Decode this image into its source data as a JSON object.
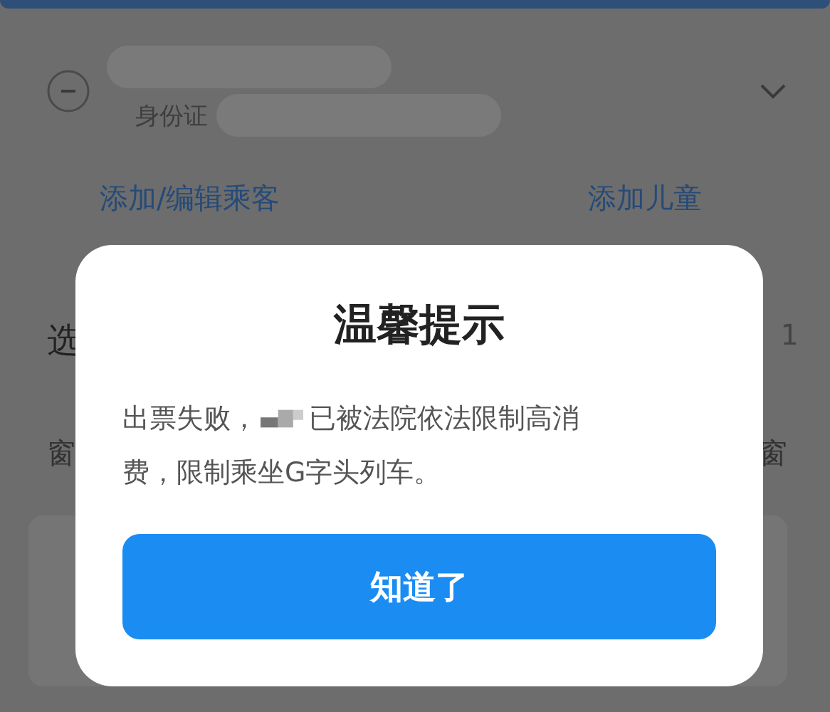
{
  "passenger": {
    "id_label": "身份证"
  },
  "links": [
    "添加/编辑乘客",
    "添加儿童"
  ],
  "section": {
    "title": "选",
    "count": "1"
  },
  "seat_row": {
    "left": "窗",
    "right": "窗"
  },
  "dialog": {
    "title": "温馨提示",
    "message_before": "出票失败，",
    "message_after": "已被法院依法限制高消",
    "message_line2": "费，限制乘坐G字头列车。",
    "button": "知道了"
  }
}
